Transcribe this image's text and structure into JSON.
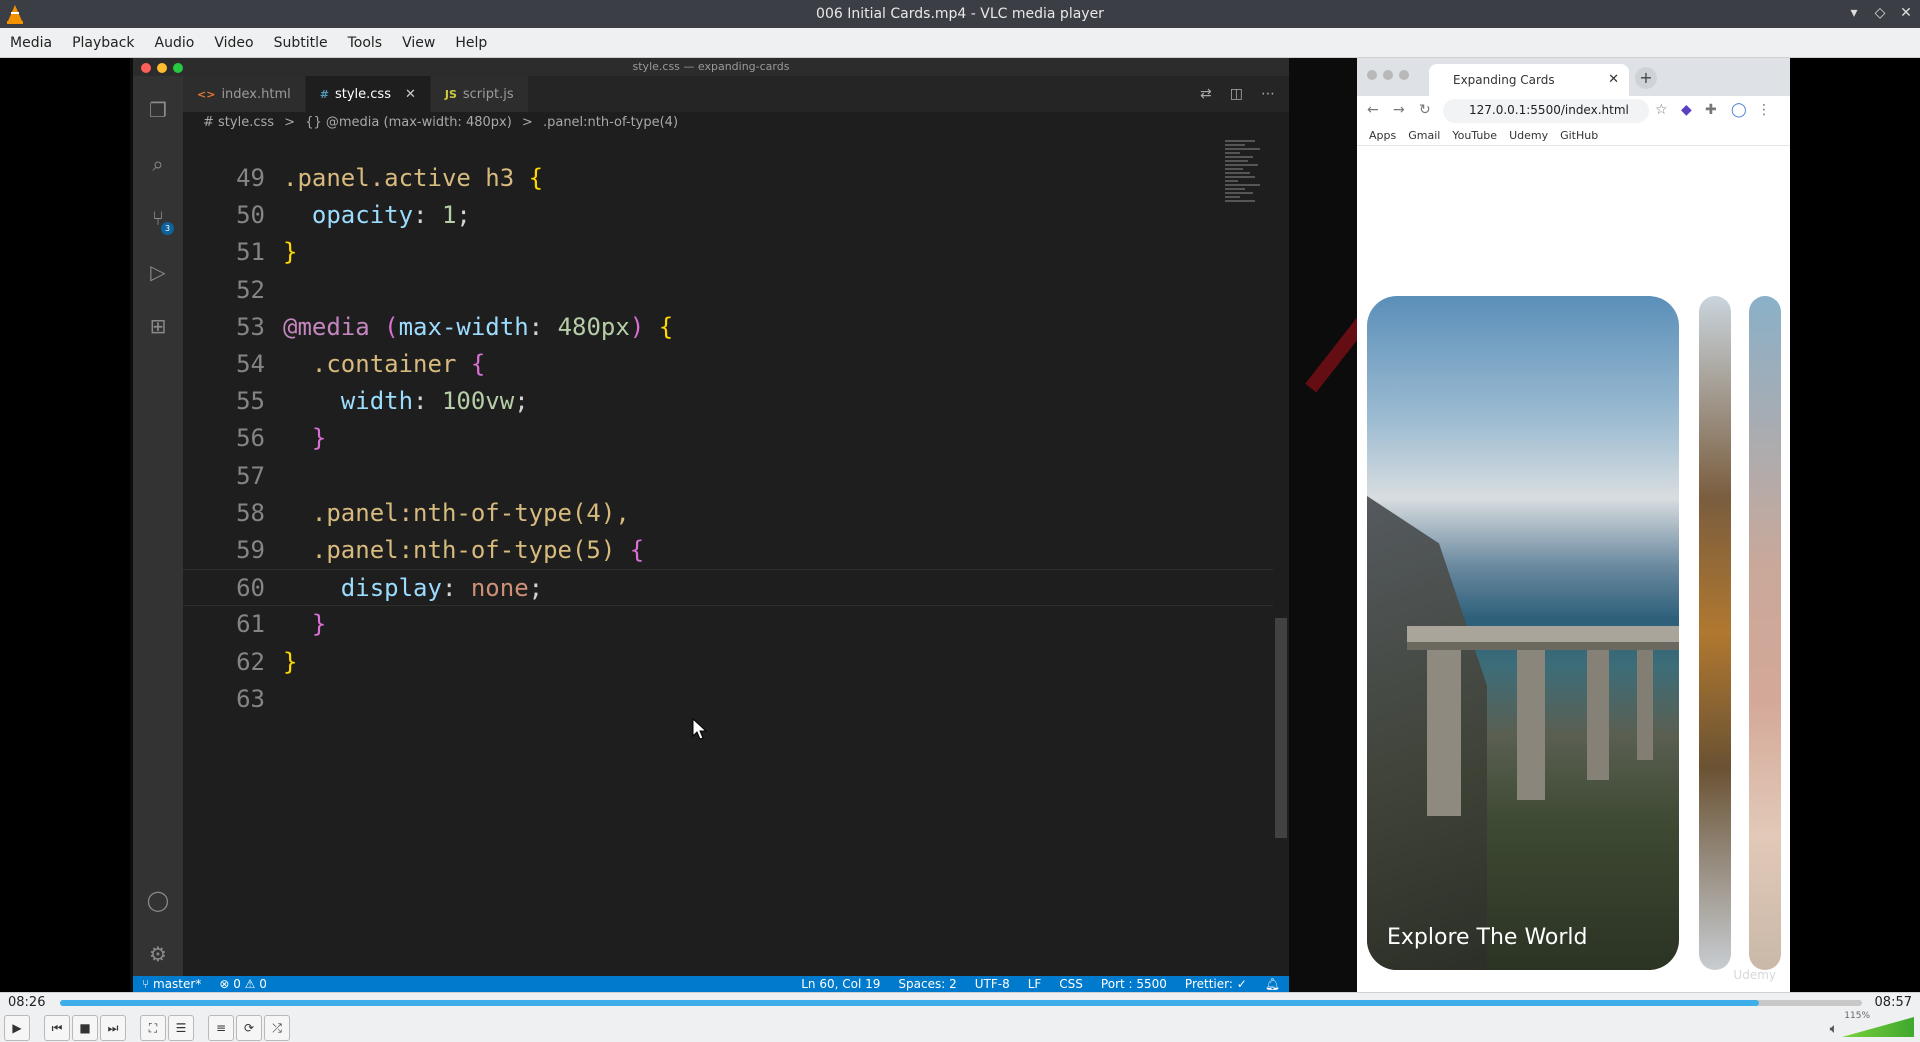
{
  "window": {
    "title": "006 Initial Cards.mp4 - VLC media player",
    "controls": [
      "▾",
      "◇",
      "✕"
    ]
  },
  "menu": [
    "Media",
    "Playback",
    "Audio",
    "Video",
    "Subtitle",
    "Tools",
    "View",
    "Help"
  ],
  "vscode": {
    "window_title": "style.css — expanding-cards",
    "tabs": [
      {
        "icon": "<>",
        "label": "index.html"
      },
      {
        "icon": "#",
        "label": "style.css"
      },
      {
        "icon": "JS",
        "label": "script.js"
      }
    ],
    "scm_badge": "3",
    "breadcrumb": [
      "# style.css",
      ">",
      "{} @media (max-width: 480px)",
      ">",
      ".panel:nth-of-type(4)"
    ],
    "lines": [
      {
        "n": "49",
        "tokens": [
          [
            ".panel.active h3 ",
            "sel"
          ],
          [
            "{",
            "brace1"
          ]
        ]
      },
      {
        "n": "50",
        "tokens": [
          [
            "  opacity",
            "prop"
          ],
          [
            ": ",
            "pun"
          ],
          [
            "1",
            "num"
          ],
          [
            ";",
            "pun"
          ]
        ]
      },
      {
        "n": "51",
        "tokens": [
          [
            "}",
            "brace1"
          ]
        ]
      },
      {
        "n": "52",
        "tokens": []
      },
      {
        "n": "53",
        "tokens": [
          [
            "@media ",
            "at"
          ],
          [
            "(",
            "brace2"
          ],
          [
            "max-width",
            "prop"
          ],
          [
            ": ",
            "pun"
          ],
          [
            "480px",
            "num"
          ],
          [
            ") ",
            "brace2"
          ],
          [
            "{",
            "brace1"
          ]
        ]
      },
      {
        "n": "54",
        "tokens": [
          [
            "  .container ",
            "sel"
          ],
          [
            "{",
            "brace2"
          ]
        ]
      },
      {
        "n": "55",
        "tokens": [
          [
            "    width",
            "prop"
          ],
          [
            ": ",
            "pun"
          ],
          [
            "100vw",
            "num"
          ],
          [
            ";",
            "pun"
          ]
        ]
      },
      {
        "n": "56",
        "tokens": [
          [
            "  }",
            "brace2"
          ]
        ]
      },
      {
        "n": "57",
        "tokens": []
      },
      {
        "n": "58",
        "tokens": [
          [
            "  .panel:nth-of-type(4),",
            "sel"
          ]
        ]
      },
      {
        "n": "59",
        "tokens": [
          [
            "  .panel:nth-of-type(5) ",
            "sel"
          ],
          [
            "{",
            "brace2"
          ]
        ]
      },
      {
        "n": "60",
        "tokens": [
          [
            "    display",
            "prop"
          ],
          [
            ": ",
            "pun"
          ],
          [
            "none",
            "val"
          ],
          [
            ";",
            "pun"
          ]
        ]
      },
      {
        "n": "61",
        "tokens": [
          [
            "  }",
            "brace2"
          ]
        ]
      },
      {
        "n": "62",
        "tokens": [
          [
            "}",
            "brace1"
          ]
        ]
      },
      {
        "n": "63",
        "tokens": []
      }
    ],
    "status": {
      "branch": "master*",
      "problems": "⊗ 0 ⚠ 0",
      "position": "Ln 60, Col 19",
      "spaces": "Spaces: 2",
      "encoding": "UTF-8",
      "eol": "LF",
      "language": "CSS",
      "port": "Port : 5500",
      "prettier": "Prettier: ✓"
    }
  },
  "browser": {
    "tab_title": "Expanding Cards",
    "url": "127.0.0.1:5500/index.html",
    "bookmarks": [
      "Apps",
      "Gmail",
      "YouTube",
      "Udemy",
      "GitHub"
    ],
    "panel_heading": "Explore The World",
    "watermark": "Udemy"
  },
  "player": {
    "elapsed": "08:26",
    "total": "08:57",
    "progress": 0.943,
    "volume_label": "115%"
  },
  "colors": {
    "vscode_status": "#007acc",
    "seek_fill": "#3daee9"
  }
}
